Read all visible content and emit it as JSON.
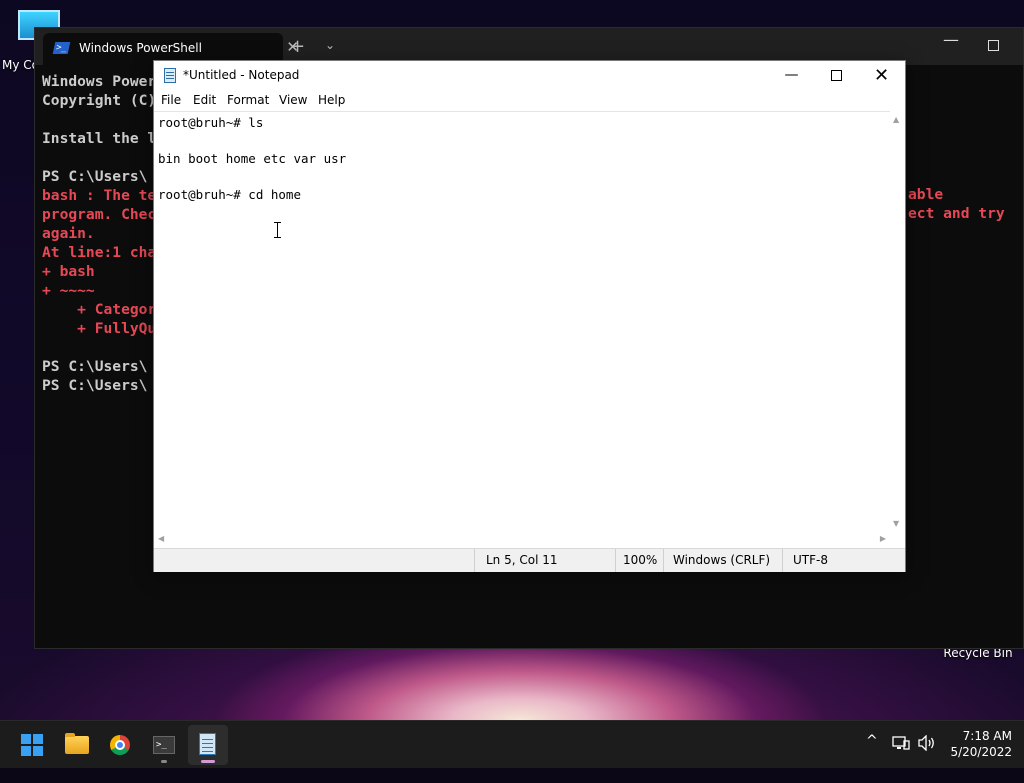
{
  "desktop": {
    "icons": [
      {
        "label": "My Co"
      },
      {
        "label": "Recycle Bin"
      }
    ]
  },
  "terminal": {
    "tab_title": "Windows PowerShell",
    "tab_close": "✕",
    "new_tab": "+",
    "dropdown": "⌄",
    "minimize": "—",
    "lines": [
      "Windows Power",
      "Copyright (C)",
      "",
      "Install the l",
      "",
      "PS C:\\Users\\",
      "bash : The te",
      "program. Chec",
      "again.",
      "At line:1 cha",
      "+ bash",
      "+ ~~~~",
      "    + Categor",
      "    + FullyQu",
      "",
      "PS C:\\Users\\",
      "PS C:\\Users\\"
    ],
    "right_fragments": {
      "line1": "able",
      "line2": "ect and try"
    }
  },
  "notepad": {
    "title": "*Untitled - Notepad",
    "controls": {
      "minimize": "—",
      "close": "✕"
    },
    "menu": [
      "File",
      "Edit",
      "Format",
      "View",
      "Help"
    ],
    "content_lines": [
      "root@bruh~# ls",
      "",
      "bin boot home etc var usr",
      "",
      "root@bruh~# cd home"
    ],
    "status": {
      "position": "Ln 5, Col 11",
      "zoom": "100%",
      "line_ending": "Windows (CRLF)",
      "encoding": "UTF-8"
    }
  },
  "taskbar": {
    "items": [
      "start-icon",
      "file-explorer-icon",
      "chrome-icon",
      "terminal-icon",
      "notepad-icon"
    ],
    "tray": {
      "chevron": "^",
      "time": "7:18 AM",
      "date": "5/20/2022"
    }
  },
  "colors": {
    "terminal_bg": "#0c0c0c",
    "terminal_error": "#e74856",
    "taskbar_bg": "#1c1c1c",
    "active_indicator": "#d29bd6"
  }
}
